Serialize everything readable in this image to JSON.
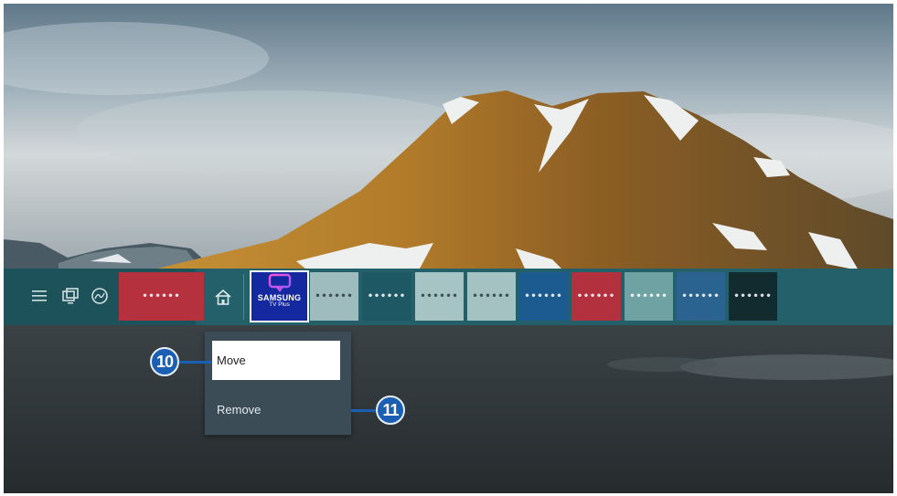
{
  "home_bar": {
    "system_icons": [
      "menu-icon",
      "source-icon",
      "ambient-icon"
    ],
    "tiles": [
      {
        "name": "app-tile-1",
        "label": "••••••",
        "color": "#b5313e"
      },
      {
        "name": "app-tile-2",
        "label": "••••••",
        "color": "#9ebcbd"
      },
      {
        "name": "app-tile-3",
        "label": "••••••",
        "color": "#1d5864"
      },
      {
        "name": "app-tile-4",
        "label": "••••••",
        "color": "#a7c4c4"
      },
      {
        "name": "app-tile-5",
        "label": "••••••",
        "color": "#a5c2c2"
      },
      {
        "name": "app-tile-6",
        "label": "••••••",
        "color": "#1c5b8f"
      },
      {
        "name": "app-tile-7",
        "label": "••••••",
        "color": "#b3313f"
      },
      {
        "name": "app-tile-8",
        "label": "••••••",
        "color": "#6fa3a3"
      },
      {
        "name": "app-tile-9",
        "label": "••••••",
        "color": "#2b6390"
      },
      {
        "name": "app-tile-10",
        "label": "••••••",
        "color": "#112b2e"
      }
    ],
    "featured_app": {
      "brand": "SAMSUNG",
      "subtitle": "TV Plus",
      "color": "#1428a0"
    }
  },
  "context_menu": {
    "move_label": "Move",
    "remove_label": "Remove"
  },
  "callouts": {
    "move": "10",
    "remove": "11"
  },
  "colors": {
    "accent": "#1a5fb4",
    "menubar": "#24606a",
    "popup": "#3b4c56"
  }
}
